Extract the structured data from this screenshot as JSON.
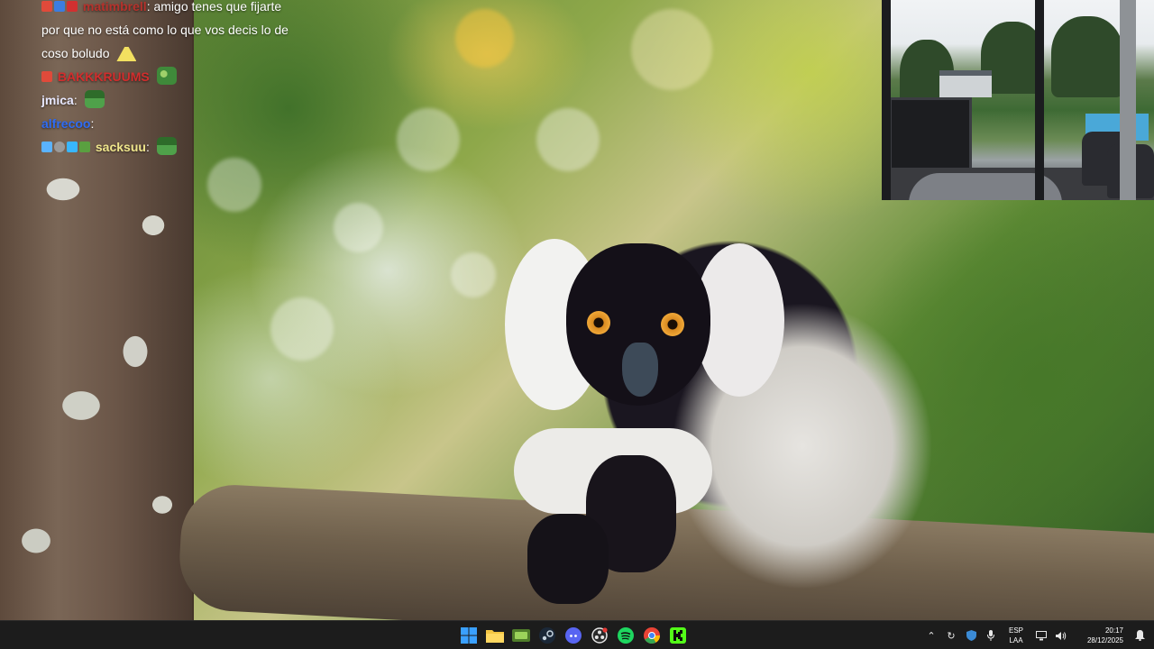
{
  "chat": {
    "lines": [
      {
        "user": "matimbrell",
        "message": ": amigo tenes que fijarte",
        "user_color": "#b6322c"
      },
      {
        "continuation": "por que no está como lo que vos decis lo de"
      },
      {
        "continuation": "coso boludo"
      },
      {
        "user": "BAKKKRUUMS",
        "user_color": "#d22d2d"
      },
      {
        "user": "jmica",
        "message": ":",
        "user_color": "#e8e8ff"
      },
      {
        "user": "alfrecoo",
        "message": ":",
        "user_color": "#2e6cf5"
      },
      {
        "user": "sacksuu",
        "message": ":",
        "user_color": "#f0e68c"
      }
    ]
  },
  "taskbar": {
    "apps": [
      {
        "name": "start-menu-button",
        "icon": "windows-icon",
        "color": "#3aa0ff"
      },
      {
        "name": "file-explorer-button",
        "icon": "folder-icon",
        "color": "#f4c542"
      },
      {
        "name": "game-launcher-button",
        "icon": "gamepad-icon",
        "color": "#7fbf3f"
      },
      {
        "name": "steam-button",
        "icon": "steam-icon",
        "color": "#c7d5e0"
      },
      {
        "name": "discord-button",
        "icon": "discord-icon",
        "color": "#5865f2"
      },
      {
        "name": "obs-button",
        "icon": "obs-icon",
        "color": "#e6e6e6"
      },
      {
        "name": "spotify-button",
        "icon": "spotify-icon",
        "color": "#1ed760"
      },
      {
        "name": "chrome-button",
        "icon": "chrome-icon",
        "color": "#ea4335"
      },
      {
        "name": "kick-button",
        "icon": "kick-icon",
        "color": "#53fc18"
      }
    ],
    "tray": {
      "language_line1": "ESP",
      "language_line2": "LAA",
      "time": "20:17",
      "date": "28/12/2025"
    }
  }
}
